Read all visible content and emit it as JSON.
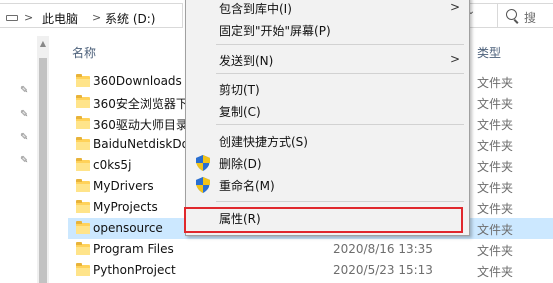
{
  "address_bar": {
    "crumbs": [
      "此电脑",
      "系统 (D:)"
    ],
    "separator": ">",
    "chevron": "⌄",
    "search_placeholder": "搜"
  },
  "columns": {
    "name": "名称",
    "type": "类型"
  },
  "files": [
    {
      "name": "360Downloads",
      "date": "",
      "type": "文件夹"
    },
    {
      "name": "360安全浏览器下",
      "date": "",
      "type": "文件夹"
    },
    {
      "name": "360驱动大师目录",
      "date": "",
      "type": "文件夹"
    },
    {
      "name": "BaiduNetdiskDo",
      "date": "",
      "type": "文件夹"
    },
    {
      "name": "c0ks5j",
      "date": "",
      "type": "文件夹"
    },
    {
      "name": "MyDrivers",
      "date": "",
      "type": "文件夹"
    },
    {
      "name": "MyProjects",
      "date": "",
      "type": "文件夹"
    },
    {
      "name": "opensource",
      "date": "",
      "type": "文件夹"
    },
    {
      "name": "Program Files",
      "date": "2020/8/16 13:35",
      "type": "文件夹"
    },
    {
      "name": "PythonProject",
      "date": "2020/5/23 15:13",
      "type": "文件夹"
    }
  ],
  "context_menu": {
    "items": [
      {
        "label": "包含到库中(I)",
        "has_submenu": true
      },
      {
        "label": "固定到\"开始\"屏幕(P)",
        "has_submenu": false
      },
      {
        "label": "发送到(N)",
        "has_submenu": true
      },
      {
        "label": "剪切(T)",
        "has_submenu": false
      },
      {
        "label": "复制(C)",
        "has_submenu": false
      },
      {
        "label": "创建快捷方式(S)",
        "has_submenu": false
      },
      {
        "label": "删除(D)",
        "has_submenu": false,
        "icon": "shield-icon"
      },
      {
        "label": "重命名(M)",
        "has_submenu": false,
        "icon": "shield-icon"
      },
      {
        "label": "属性(R)",
        "has_submenu": false
      }
    ],
    "submenu_arrow": ">"
  },
  "colors": {
    "selection": "#cce8ff",
    "highlight_box": "#e0282d",
    "menu_bg": "#f2f2f2",
    "column_header": "#4c607a"
  }
}
